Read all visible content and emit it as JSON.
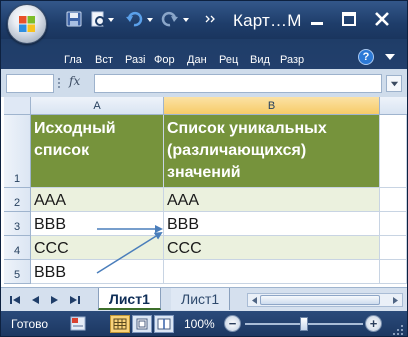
{
  "window": {
    "title": "Карт…М",
    "buttons": [
      "minimize",
      "restore",
      "close"
    ]
  },
  "quick_access": [
    "save-icon",
    "print-preview-icon",
    "undo-icon",
    "redo-icon"
  ],
  "ribbon": {
    "tabs": [
      "Гла",
      "Вст",
      "Разі",
      "Фор",
      "Дан",
      "Рец",
      "Вид",
      "Разр"
    ],
    "help": "?"
  },
  "formula_bar": {
    "fx": "fx",
    "name_box": "",
    "content": ""
  },
  "grid": {
    "columns": [
      "A",
      "B"
    ],
    "rows": [
      {
        "num": "1",
        "a": "Исходный список",
        "b": "Список уникальных (различающихся) значений",
        "style": "hdr"
      },
      {
        "num": "2",
        "a": "AAA",
        "b": "AAA",
        "style": "band"
      },
      {
        "num": "3",
        "a": "BBB",
        "b": "BBB",
        "style": "plain"
      },
      {
        "num": "4",
        "a": "CCC",
        "b": "CCC",
        "style": "band"
      },
      {
        "num": "5",
        "a": "BBB",
        "b": "",
        "style": "plain"
      }
    ],
    "colors": {
      "header": "#76933c",
      "band": "#ebf1de",
      "arrow": "#4a7ebb"
    }
  },
  "sheets": {
    "active": "Лист1",
    "other": "Лист1"
  },
  "status": {
    "text": "Готово",
    "zoom": "100%",
    "zoom_fraction": 0.5
  }
}
